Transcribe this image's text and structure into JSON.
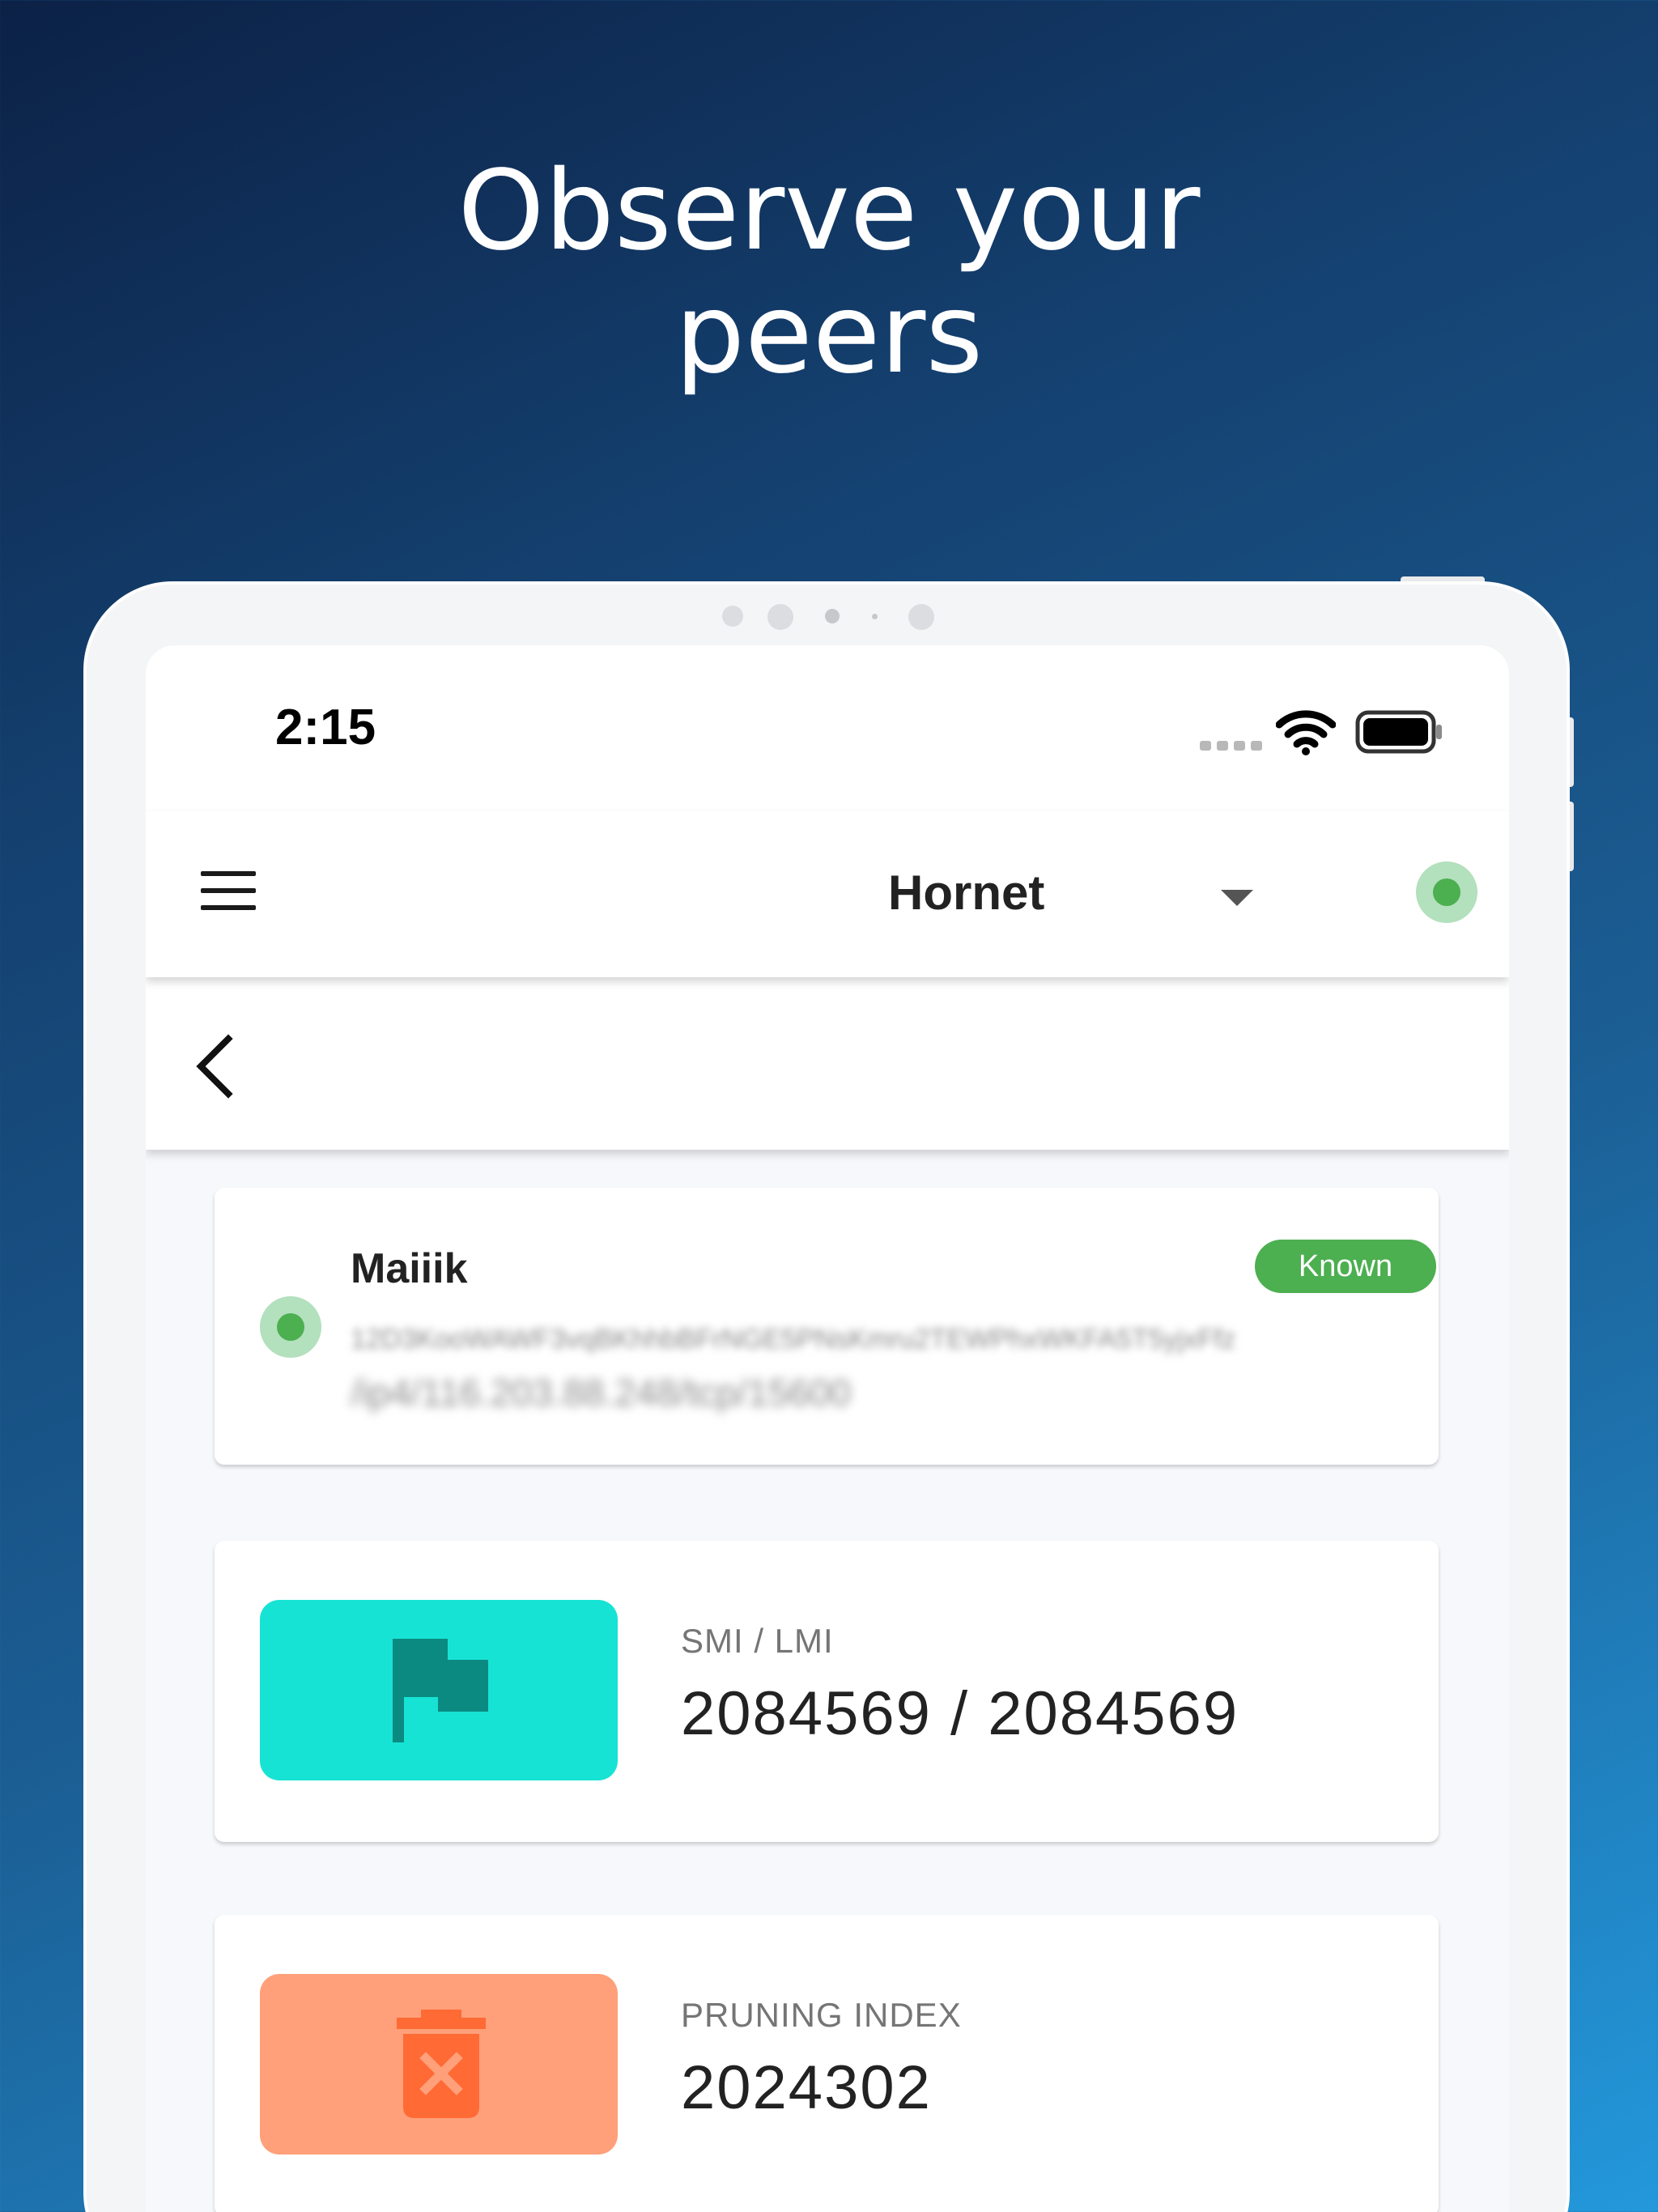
{
  "headline": {
    "line1": "Observe your",
    "line2": "peers"
  },
  "status_bar": {
    "time": "2:15"
  },
  "app_bar": {
    "node_name": "Hornet",
    "connection_status_color": "#4caf50"
  },
  "peer": {
    "name": "Maiiik",
    "relation_badge": "Known",
    "id": "12D3KooWAWF3vqBKhhbBFrNGE5PNsKmru2TEWPhxWKFA5T5yjxFfz",
    "address": "/ip4/116.203.88.248/tcp/15600"
  },
  "stats": [
    {
      "label": "SMI / LMI",
      "value": "2084569 / 2084569",
      "icon": "flag-icon",
      "color": "#17e3d4",
      "icon_color": "#0b8a82"
    },
    {
      "label": "PRUNING INDEX",
      "value": "2024302",
      "icon": "trash-delete-icon",
      "color": "#ffa07a",
      "icon_color": "#ff6a35"
    }
  ]
}
